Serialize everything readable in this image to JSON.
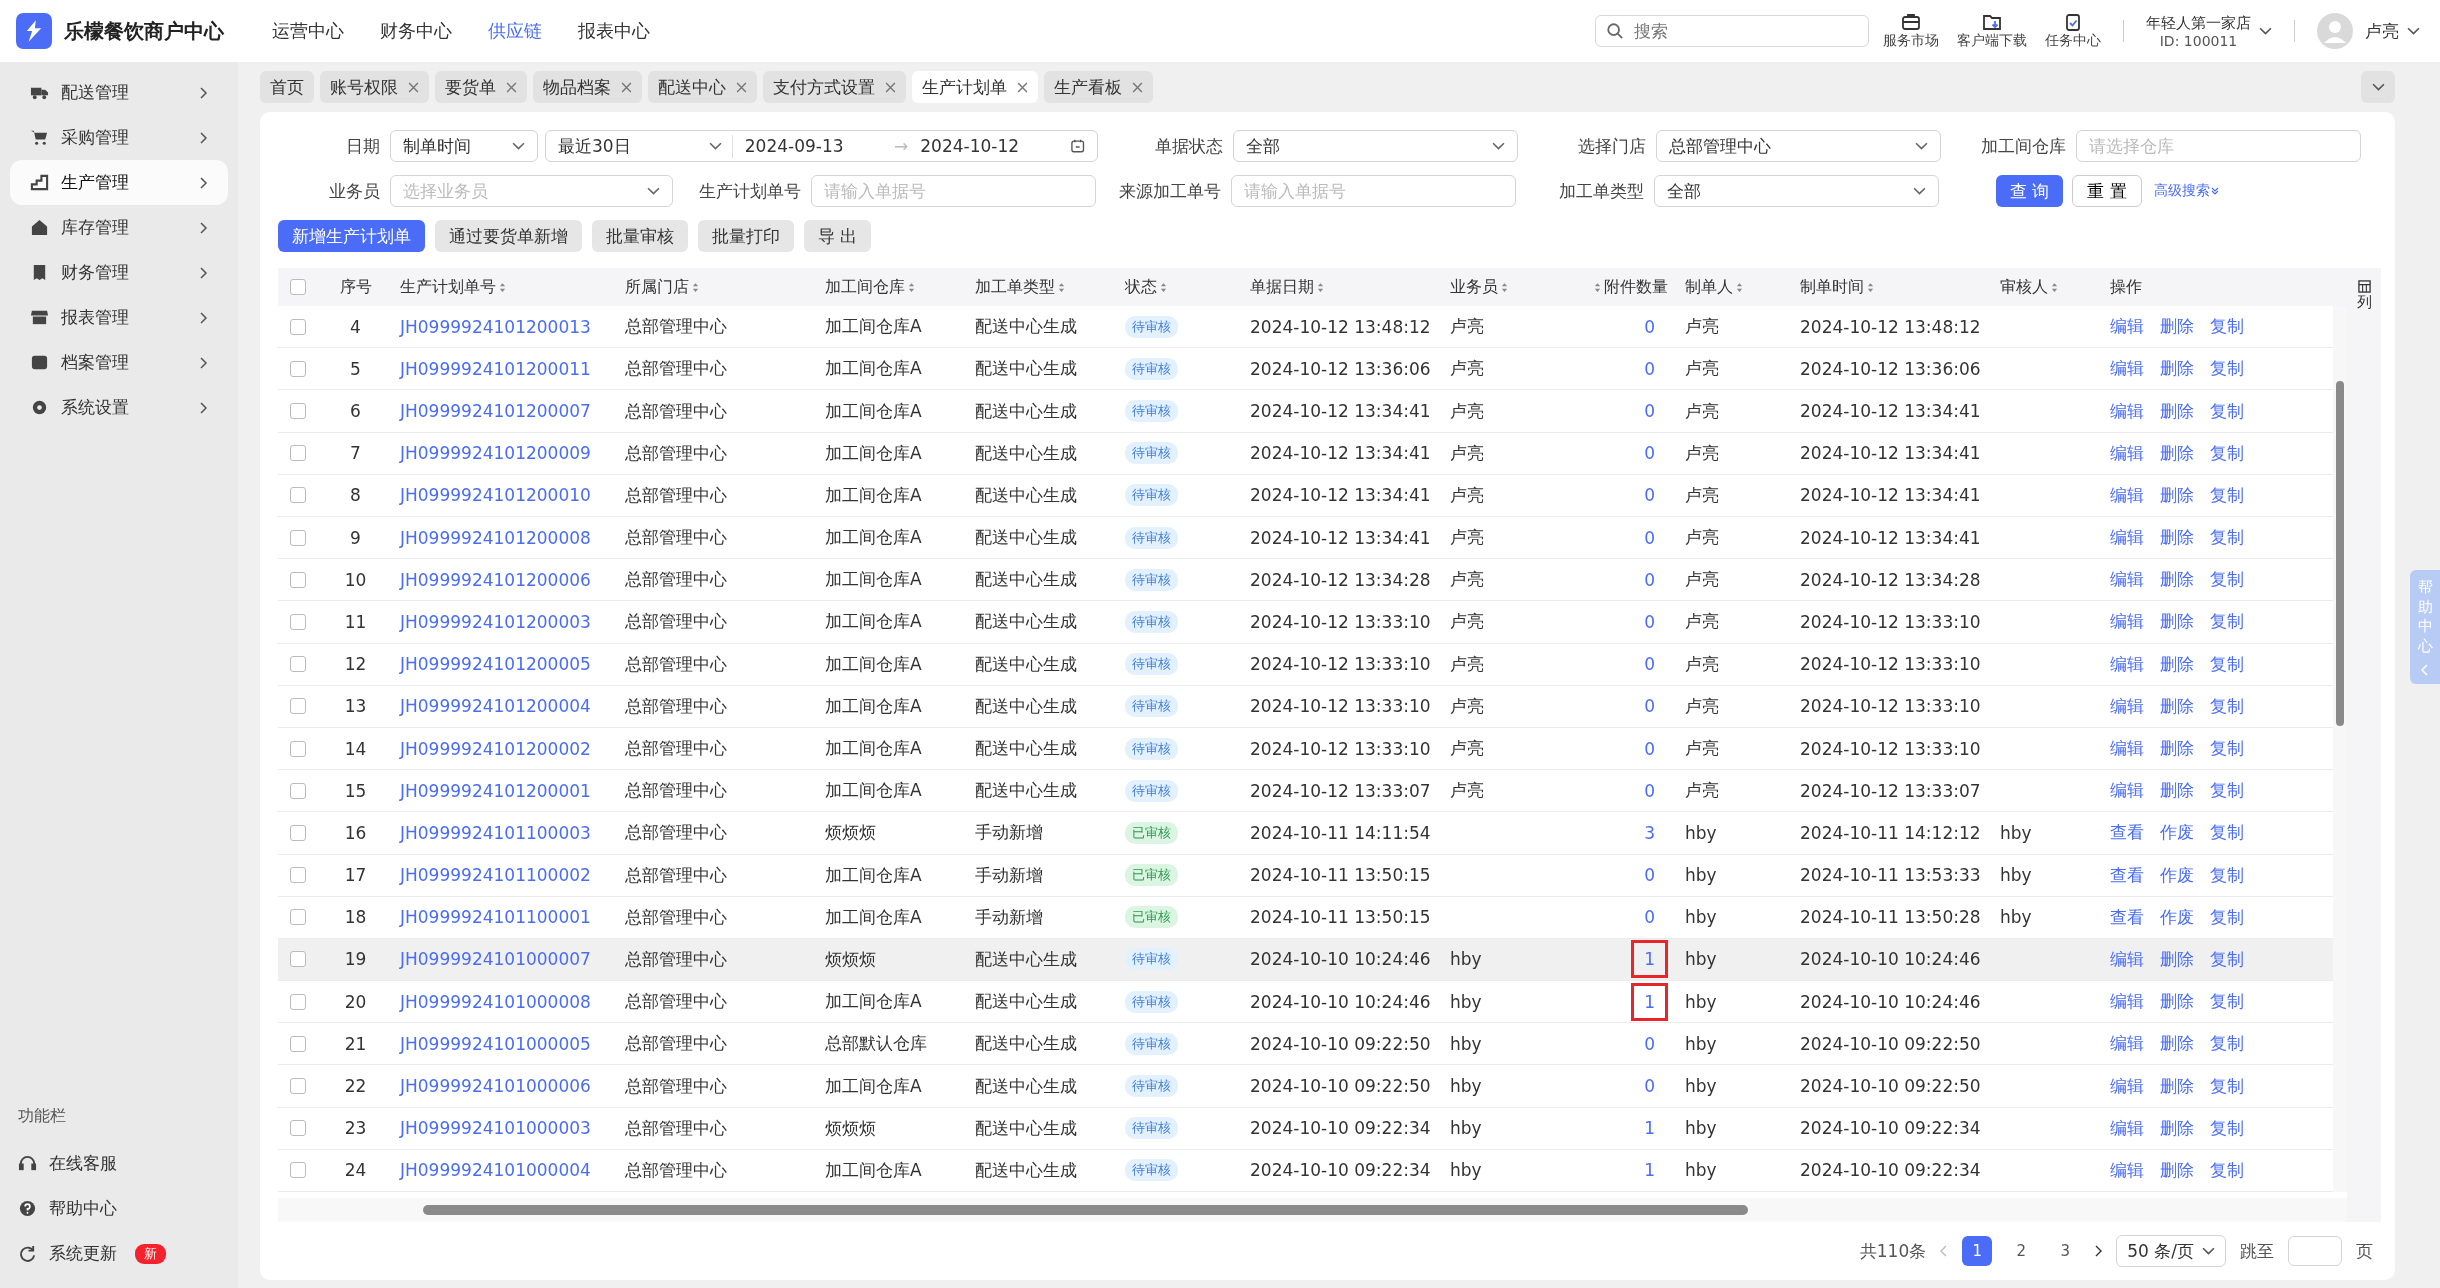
{
  "header": {
    "brand": "乐檬餐饮商户中心",
    "nav": [
      {
        "label": "运营中心",
        "selected": false
      },
      {
        "label": "财务中心",
        "selected": false
      },
      {
        "label": "供应链",
        "selected": true
      },
      {
        "label": "报表中心",
        "selected": false
      }
    ],
    "search": {
      "placeholder": "搜索"
    },
    "tools": [
      {
        "label": "服务市场",
        "kind": "market"
      },
      {
        "label": "客户端下载",
        "kind": "download"
      },
      {
        "label": "任务中心",
        "kind": "task"
      }
    ],
    "store": {
      "name": "年轻人第一家店",
      "id": "ID: 100011"
    },
    "user": "卢亮"
  },
  "sidebar": {
    "items": [
      {
        "label": "配送管理",
        "selected": false
      },
      {
        "label": "采购管理",
        "selected": false
      },
      {
        "label": "生产管理",
        "selected": true
      },
      {
        "label": "库存管理",
        "selected": false
      },
      {
        "label": "财务管理",
        "selected": false
      },
      {
        "label": "报表管理",
        "selected": false
      },
      {
        "label": "档案管理",
        "selected": false
      },
      {
        "label": "系统设置",
        "selected": false
      }
    ],
    "footer_title": "功能栏",
    "footer": [
      {
        "label": "在线客服"
      },
      {
        "label": "帮助中心"
      },
      {
        "label": "系统更新",
        "badge": "新"
      }
    ]
  },
  "tabs": [
    {
      "label": "首页",
      "closable": false,
      "selected": false
    },
    {
      "label": "账号权限",
      "closable": true,
      "selected": false
    },
    {
      "label": "要货单",
      "closable": true,
      "selected": false
    },
    {
      "label": "物品档案",
      "closable": true,
      "selected": false
    },
    {
      "label": "配送中心",
      "closable": true,
      "selected": false
    },
    {
      "label": "支付方式设置",
      "closable": true,
      "selected": false
    },
    {
      "label": "生产计划单",
      "closable": true,
      "selected": true
    },
    {
      "label": "生产看板",
      "closable": true,
      "selected": false
    }
  ],
  "filters": {
    "date": {
      "label": "日期",
      "field": "制单时间",
      "range": "最近30日",
      "start": "2024-09-13",
      "separator": "→",
      "end": "2024-10-12"
    },
    "status": {
      "label": "单据状态",
      "value": "全部"
    },
    "store": {
      "label": "选择门店",
      "value": "总部管理中心"
    },
    "warehouse": {
      "label": "加工间仓库",
      "placeholder": "请选择仓库"
    },
    "salesman": {
      "label": "业务员",
      "placeholder": "选择业务员"
    },
    "plan_no": {
      "label": "生产计划单号",
      "placeholder": "请输入单据号"
    },
    "source_no": {
      "label": "来源加工单号",
      "placeholder": "请输入单据号"
    },
    "type": {
      "label": "加工单类型",
      "value": "全部"
    },
    "query": "查 询",
    "reset": "重 置",
    "advanced": "高级搜索"
  },
  "toolbar": [
    {
      "label": "新增生产计划单",
      "kind": "primary"
    },
    {
      "label": "通过要货单新增",
      "kind": "default"
    },
    {
      "label": "批量审核",
      "kind": "default"
    },
    {
      "label": "批量打印",
      "kind": "default"
    },
    {
      "label": "导 出",
      "kind": "default"
    }
  ],
  "table": {
    "columns": [
      {
        "label": "序号",
        "sortable": false
      },
      {
        "label": "生产计划单号",
        "sortable": true
      },
      {
        "label": "所属门店",
        "sortable": true
      },
      {
        "label": "加工间仓库",
        "sortable": true
      },
      {
        "label": "加工单类型",
        "sortable": true
      },
      {
        "label": "状态",
        "sortable": true
      },
      {
        "label": "单据日期",
        "sortable": true
      },
      {
        "label": "业务员",
        "sortable": true
      },
      {
        "label": "附件数量",
        "sortable": true
      },
      {
        "label": "制单人",
        "sortable": true
      },
      {
        "label": "制单时间",
        "sortable": true
      },
      {
        "label": "审核人",
        "sortable": true
      },
      {
        "label": "操作",
        "sortable": false
      }
    ],
    "settings": "列",
    "select_all_checked": false,
    "rows": [
      {
        "checked": false,
        "hover": false,
        "annotated": false,
        "no": "4",
        "code": "JH0999924101200013",
        "store": "总部管理中心",
        "warehouse": "加工间仓库A",
        "type": "配送中心生成",
        "status": {
          "text": "待审核",
          "kind": "pending"
        },
        "date": "2024-10-12 13:48:12",
        "salesman": "卢亮",
        "attachments": "0",
        "maker": "卢亮",
        "made_at": "2024-10-12 13:48:12",
        "reviewer": "",
        "actions": [
          "编辑",
          "删除",
          "复制"
        ]
      },
      {
        "checked": false,
        "hover": false,
        "annotated": false,
        "no": "5",
        "code": "JH0999924101200011",
        "store": "总部管理中心",
        "warehouse": "加工间仓库A",
        "type": "配送中心生成",
        "status": {
          "text": "待审核",
          "kind": "pending"
        },
        "date": "2024-10-12 13:36:06",
        "salesman": "卢亮",
        "attachments": "0",
        "maker": "卢亮",
        "made_at": "2024-10-12 13:36:06",
        "reviewer": "",
        "actions": [
          "编辑",
          "删除",
          "复制"
        ]
      },
      {
        "checked": false,
        "hover": false,
        "annotated": false,
        "no": "6",
        "code": "JH0999924101200007",
        "store": "总部管理中心",
        "warehouse": "加工间仓库A",
        "type": "配送中心生成",
        "status": {
          "text": "待审核",
          "kind": "pending"
        },
        "date": "2024-10-12 13:34:41",
        "salesman": "卢亮",
        "attachments": "0",
        "maker": "卢亮",
        "made_at": "2024-10-12 13:34:41",
        "reviewer": "",
        "actions": [
          "编辑",
          "删除",
          "复制"
        ]
      },
      {
        "checked": false,
        "hover": false,
        "annotated": false,
        "no": "7",
        "code": "JH0999924101200009",
        "store": "总部管理中心",
        "warehouse": "加工间仓库A",
        "type": "配送中心生成",
        "status": {
          "text": "待审核",
          "kind": "pending"
        },
        "date": "2024-10-12 13:34:41",
        "salesman": "卢亮",
        "attachments": "0",
        "maker": "卢亮",
        "made_at": "2024-10-12 13:34:41",
        "reviewer": "",
        "actions": [
          "编辑",
          "删除",
          "复制"
        ]
      },
      {
        "checked": false,
        "hover": false,
        "annotated": false,
        "no": "8",
        "code": "JH0999924101200010",
        "store": "总部管理中心",
        "warehouse": "加工间仓库A",
        "type": "配送中心生成",
        "status": {
          "text": "待审核",
          "kind": "pending"
        },
        "date": "2024-10-12 13:34:41",
        "salesman": "卢亮",
        "attachments": "0",
        "maker": "卢亮",
        "made_at": "2024-10-12 13:34:41",
        "reviewer": "",
        "actions": [
          "编辑",
          "删除",
          "复制"
        ]
      },
      {
        "checked": false,
        "hover": false,
        "annotated": false,
        "no": "9",
        "code": "JH0999924101200008",
        "store": "总部管理中心",
        "warehouse": "加工间仓库A",
        "type": "配送中心生成",
        "status": {
          "text": "待审核",
          "kind": "pending"
        },
        "date": "2024-10-12 13:34:41",
        "salesman": "卢亮",
        "attachments": "0",
        "maker": "卢亮",
        "made_at": "2024-10-12 13:34:41",
        "reviewer": "",
        "actions": [
          "编辑",
          "删除",
          "复制"
        ]
      },
      {
        "checked": false,
        "hover": false,
        "annotated": false,
        "no": "10",
        "code": "JH0999924101200006",
        "store": "总部管理中心",
        "warehouse": "加工间仓库A",
        "type": "配送中心生成",
        "status": {
          "text": "待审核",
          "kind": "pending"
        },
        "date": "2024-10-12 13:34:28",
        "salesman": "卢亮",
        "attachments": "0",
        "maker": "卢亮",
        "made_at": "2024-10-12 13:34:28",
        "reviewer": "",
        "actions": [
          "编辑",
          "删除",
          "复制"
        ]
      },
      {
        "checked": false,
        "hover": false,
        "annotated": false,
        "no": "11",
        "code": "JH0999924101200003",
        "store": "总部管理中心",
        "warehouse": "加工间仓库A",
        "type": "配送中心生成",
        "status": {
          "text": "待审核",
          "kind": "pending"
        },
        "date": "2024-10-12 13:33:10",
        "salesman": "卢亮",
        "attachments": "0",
        "maker": "卢亮",
        "made_at": "2024-10-12 13:33:10",
        "reviewer": "",
        "actions": [
          "编辑",
          "删除",
          "复制"
        ]
      },
      {
        "checked": false,
        "hover": false,
        "annotated": false,
        "no": "12",
        "code": "JH0999924101200005",
        "store": "总部管理中心",
        "warehouse": "加工间仓库A",
        "type": "配送中心生成",
        "status": {
          "text": "待审核",
          "kind": "pending"
        },
        "date": "2024-10-12 13:33:10",
        "salesman": "卢亮",
        "attachments": "0",
        "maker": "卢亮",
        "made_at": "2024-10-12 13:33:10",
        "reviewer": "",
        "actions": [
          "编辑",
          "删除",
          "复制"
        ]
      },
      {
        "checked": false,
        "hover": false,
        "annotated": false,
        "no": "13",
        "code": "JH0999924101200004",
        "store": "总部管理中心",
        "warehouse": "加工间仓库A",
        "type": "配送中心生成",
        "status": {
          "text": "待审核",
          "kind": "pending"
        },
        "date": "2024-10-12 13:33:10",
        "salesman": "卢亮",
        "attachments": "0",
        "maker": "卢亮",
        "made_at": "2024-10-12 13:33:10",
        "reviewer": "",
        "actions": [
          "编辑",
          "删除",
          "复制"
        ]
      },
      {
        "checked": false,
        "hover": false,
        "annotated": false,
        "no": "14",
        "code": "JH0999924101200002",
        "store": "总部管理中心",
        "warehouse": "加工间仓库A",
        "type": "配送中心生成",
        "status": {
          "text": "待审核",
          "kind": "pending"
        },
        "date": "2024-10-12 13:33:10",
        "salesman": "卢亮",
        "attachments": "0",
        "maker": "卢亮",
        "made_at": "2024-10-12 13:33:10",
        "reviewer": "",
        "actions": [
          "编辑",
          "删除",
          "复制"
        ]
      },
      {
        "checked": false,
        "hover": false,
        "annotated": false,
        "no": "15",
        "code": "JH0999924101200001",
        "store": "总部管理中心",
        "warehouse": "加工间仓库A",
        "type": "配送中心生成",
        "status": {
          "text": "待审核",
          "kind": "pending"
        },
        "date": "2024-10-12 13:33:07",
        "salesman": "卢亮",
        "attachments": "0",
        "maker": "卢亮",
        "made_at": "2024-10-12 13:33:07",
        "reviewer": "",
        "actions": [
          "编辑",
          "删除",
          "复制"
        ]
      },
      {
        "checked": false,
        "hover": false,
        "annotated": false,
        "no": "16",
        "code": "JH0999924101100003",
        "store": "总部管理中心",
        "warehouse": "烦烦烦",
        "type": "手动新增",
        "status": {
          "text": "已审核",
          "kind": "approved"
        },
        "date": "2024-10-11 14:11:54",
        "salesman": "",
        "attachments": "3",
        "maker": "hby",
        "made_at": "2024-10-11 14:12:12",
        "reviewer": "hby",
        "actions": [
          "查看",
          "作废",
          "复制"
        ]
      },
      {
        "checked": false,
        "hover": false,
        "annotated": false,
        "no": "17",
        "code": "JH0999924101100002",
        "store": "总部管理中心",
        "warehouse": "加工间仓库A",
        "type": "手动新增",
        "status": {
          "text": "已审核",
          "kind": "approved"
        },
        "date": "2024-10-11 13:50:15",
        "salesman": "",
        "attachments": "0",
        "maker": "hby",
        "made_at": "2024-10-11 13:53:33",
        "reviewer": "hby",
        "actions": [
          "查看",
          "作废",
          "复制"
        ]
      },
      {
        "checked": false,
        "hover": false,
        "annotated": false,
        "no": "18",
        "code": "JH0999924101100001",
        "store": "总部管理中心",
        "warehouse": "加工间仓库A",
        "type": "手动新增",
        "status": {
          "text": "已审核",
          "kind": "approved"
        },
        "date": "2024-10-11 13:50:15",
        "salesman": "",
        "attachments": "0",
        "maker": "hby",
        "made_at": "2024-10-11 13:50:28",
        "reviewer": "hby",
        "actions": [
          "查看",
          "作废",
          "复制"
        ]
      },
      {
        "checked": false,
        "hover": true,
        "annotated": true,
        "no": "19",
        "code": "JH0999924101000007",
        "store": "总部管理中心",
        "warehouse": "烦烦烦",
        "type": "配送中心生成",
        "status": {
          "text": "待审核",
          "kind": "pending"
        },
        "date": "2024-10-10 10:24:46",
        "salesman": "hby",
        "attachments": "1",
        "maker": "hby",
        "made_at": "2024-10-10 10:24:46",
        "reviewer": "",
        "actions": [
          "编辑",
          "删除",
          "复制"
        ]
      },
      {
        "checked": false,
        "hover": false,
        "annotated": true,
        "no": "20",
        "code": "JH0999924101000008",
        "store": "总部管理中心",
        "warehouse": "加工间仓库A",
        "type": "配送中心生成",
        "status": {
          "text": "待审核",
          "kind": "pending"
        },
        "date": "2024-10-10 10:24:46",
        "salesman": "hby",
        "attachments": "1",
        "maker": "hby",
        "made_at": "2024-10-10 10:24:46",
        "reviewer": "",
        "actions": [
          "编辑",
          "删除",
          "复制"
        ]
      },
      {
        "checked": false,
        "hover": false,
        "annotated": false,
        "no": "21",
        "code": "JH0999924101000005",
        "store": "总部管理中心",
        "warehouse": "总部默认仓库",
        "type": "配送中心生成",
        "status": {
          "text": "待审核",
          "kind": "pending"
        },
        "date": "2024-10-10 09:22:50",
        "salesman": "hby",
        "attachments": "0",
        "maker": "hby",
        "made_at": "2024-10-10 09:22:50",
        "reviewer": "",
        "actions": [
          "编辑",
          "删除",
          "复制"
        ]
      },
      {
        "checked": false,
        "hover": false,
        "annotated": false,
        "no": "22",
        "code": "JH0999924101000006",
        "store": "总部管理中心",
        "warehouse": "加工间仓库A",
        "type": "配送中心生成",
        "status": {
          "text": "待审核",
          "kind": "pending"
        },
        "date": "2024-10-10 09:22:50",
        "salesman": "hby",
        "attachments": "0",
        "maker": "hby",
        "made_at": "2024-10-10 09:22:50",
        "reviewer": "",
        "actions": [
          "编辑",
          "删除",
          "复制"
        ]
      },
      {
        "checked": false,
        "hover": false,
        "annotated": false,
        "no": "23",
        "code": "JH0999924101000003",
        "store": "总部管理中心",
        "warehouse": "烦烦烦",
        "type": "配送中心生成",
        "status": {
          "text": "待审核",
          "kind": "pending"
        },
        "date": "2024-10-10 09:22:34",
        "salesman": "hby",
        "attachments": "1",
        "maker": "hby",
        "made_at": "2024-10-10 09:22:34",
        "reviewer": "",
        "actions": [
          "编辑",
          "删除",
          "复制"
        ]
      },
      {
        "checked": false,
        "hover": false,
        "annotated": false,
        "no": "24",
        "code": "JH0999924101000004",
        "store": "总部管理中心",
        "warehouse": "加工间仓库A",
        "type": "配送中心生成",
        "status": {
          "text": "待审核",
          "kind": "pending"
        },
        "date": "2024-10-10 09:22:34",
        "salesman": "hby",
        "attachments": "1",
        "maker": "hby",
        "made_at": "2024-10-10 09:22:34",
        "reviewer": "",
        "actions": [
          "编辑",
          "删除",
          "复制"
        ]
      }
    ]
  },
  "pagination": {
    "total": "共110条",
    "pages": [
      {
        "label": "1",
        "selected": true
      },
      {
        "label": "2",
        "selected": false
      },
      {
        "label": "3",
        "selected": false
      }
    ],
    "page_size": "50 条/页",
    "jump_label": "跳至",
    "jump_suffix": "页"
  },
  "help_tab": "帮助中心"
}
